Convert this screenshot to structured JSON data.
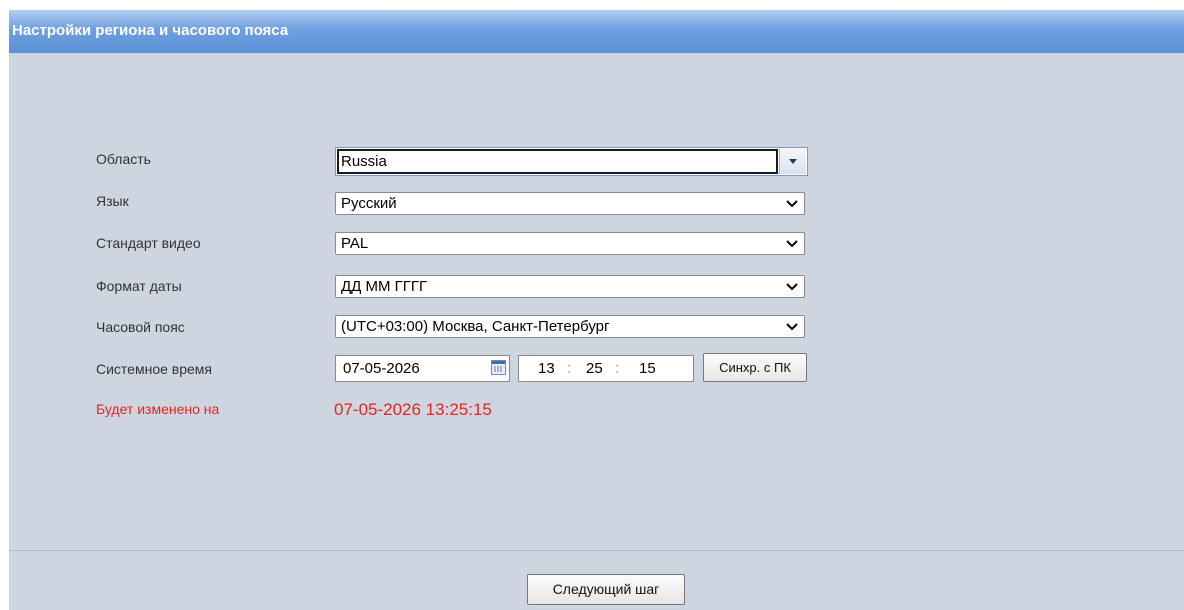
{
  "header": {
    "title": "Настройки региона и часового пояса"
  },
  "form": {
    "region": {
      "label": "Область",
      "value": "Russia"
    },
    "language": {
      "label": "Язык",
      "value": "Русский"
    },
    "video_standard": {
      "label": "Стандарт видео",
      "value": "PAL"
    },
    "date_format": {
      "label": "Формат даты",
      "value": "ДД ММ ГГГГ"
    },
    "timezone": {
      "label": "Часовой пояс",
      "value": "(UTC+03:00) Москва, Санкт-Петербург"
    },
    "system_time": {
      "label": "Системное время",
      "date": "07-05-2026",
      "hour": "13",
      "minute": "25",
      "second": "15",
      "separator": ":",
      "sync_label": "Синхр. с ПК"
    },
    "will_change": {
      "label": "Будет изменено на",
      "value": "07-05-2026 13:25:15"
    }
  },
  "footer": {
    "next_label": "Следующий шаг"
  },
  "colors": {
    "header_blue": "#5c90d8",
    "panel_bg": "#ccd5e0",
    "alert_red": "#e8241c"
  }
}
